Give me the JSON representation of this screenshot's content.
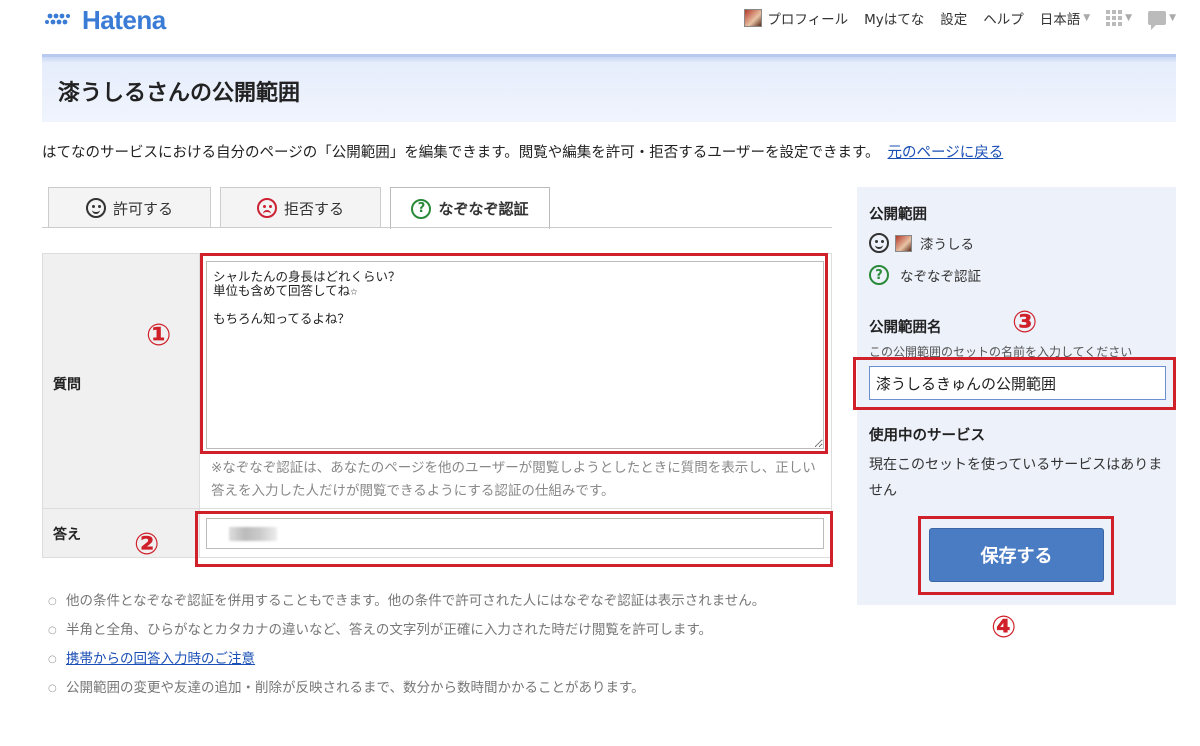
{
  "header": {
    "logo_text": "Hatena",
    "nav": {
      "profile": "プロフィール",
      "my": "Myはてな",
      "settings": "設定",
      "help": "ヘルプ",
      "language": "日本語"
    }
  },
  "page": {
    "title": "漆うしるさんの公開範囲",
    "intro": "はてなのサービスにおける自分のページの「公開範囲」を編集できます。閲覧や編集を許可・拒否するユーザーを設定できます。",
    "back_link": "元のページに戻る"
  },
  "tabs": [
    {
      "label": "許可する"
    },
    {
      "label": "拒否する"
    },
    {
      "label": "なぞなぞ認証"
    }
  ],
  "form": {
    "question_label": "質問",
    "question_value": "シャルたんの身長はどれくらい？\n単位も含めて回答してね☆\n\nもちろん知ってるよね？",
    "question_note": "※なぞなぞ認証は、あなたのページを他のユーザーが閲覧しようとしたときに質問を表示し、正しい答えを入力した人だけが閲覧できるようにする認証の仕組みです。",
    "answer_label": "答え"
  },
  "notes": [
    "他の条件となぞなぞ認証を併用することもできます。他の条件で許可された人にはなぞなぞ認証は表示されません。",
    "半角と全角、ひらがなとカタカナの違いなど、答えの文字列が正確に入力された時だけ閲覧を許可します。",
    "携帯からの回答入力時のご注意",
    "公開範囲の変更や友達の追加・削除が反映されるまで、数分から数時間かかることがあります。"
  ],
  "side": {
    "scope_title": "公開範囲",
    "scope_user": "漆うしる",
    "scope_riddle": "なぞなぞ認証",
    "name_title": "公開範囲名",
    "name_hint": "この公開範囲のセットの名前を入力してください",
    "name_value": "漆うしるきゅんの公開範囲",
    "services_title": "使用中のサービス",
    "services_text": "現在このセットを使っているサービスはありません",
    "save_label": "保存する"
  },
  "annotations": {
    "n1": "①",
    "n2": "②",
    "n3": "③",
    "n4": "④"
  },
  "colors": {
    "accent": "#4a7cc4",
    "annotation_red": "#d0202a",
    "side_bg": "#edf1fa",
    "link": "#1a4fb5"
  }
}
